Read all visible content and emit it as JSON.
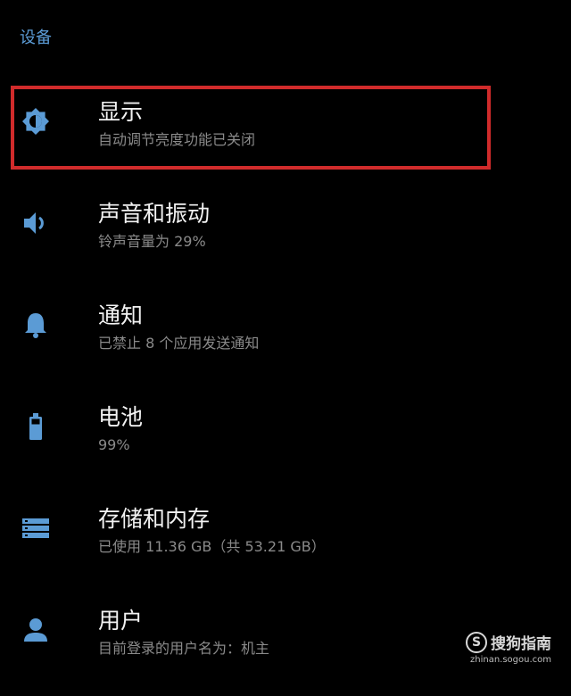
{
  "section": {
    "header": "设备"
  },
  "colors": {
    "accent": "#5b9bd5",
    "highlight_border": "#d02b2b"
  },
  "items": [
    {
      "id": "display",
      "icon": "brightness-icon",
      "title": "显示",
      "summary": "自动调节亮度功能已关闭"
    },
    {
      "id": "sound",
      "icon": "volume-icon",
      "title": "声音和振动",
      "summary": "铃声音量为 29%"
    },
    {
      "id": "notifications",
      "icon": "bell-icon",
      "title": "通知",
      "summary": "已禁止 8 个应用发送通知"
    },
    {
      "id": "battery",
      "icon": "battery-icon",
      "title": "电池",
      "summary": "99%"
    },
    {
      "id": "storage",
      "icon": "storage-icon",
      "title": "存储和内存",
      "summary": "已使用 11.36 GB（共 53.21 GB）"
    },
    {
      "id": "users",
      "icon": "person-icon",
      "title": "用户",
      "summary": "目前登录的用户名为：机主"
    }
  ],
  "watermark": {
    "logo": "S",
    "name": "搜狗指南",
    "url": "zhinan.sogou.com"
  }
}
